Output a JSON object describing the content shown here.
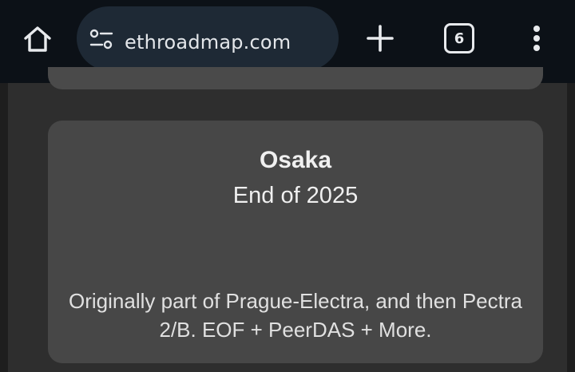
{
  "browser": {
    "url": "ethroadmap.com",
    "tab_count": "6",
    "icons": {
      "home": "home-icon",
      "site_settings": "tune-icon",
      "new_tab": "plus-icon",
      "tab_switcher": "tab-count-icon",
      "menu": "more-vert-icon"
    }
  },
  "card": {
    "title": "Osaka",
    "date": "End of 2025",
    "description": "Originally part of Prague-Electra, and then Pectra 2/B. EOF + PeerDAS + More."
  },
  "colors": {
    "toolbar_bg": "#0c1117",
    "omnibox_bg": "#1e2935",
    "panel_bg": "#2e2e2e",
    "card_bg": "#474747",
    "text": "#f0f0f0"
  }
}
